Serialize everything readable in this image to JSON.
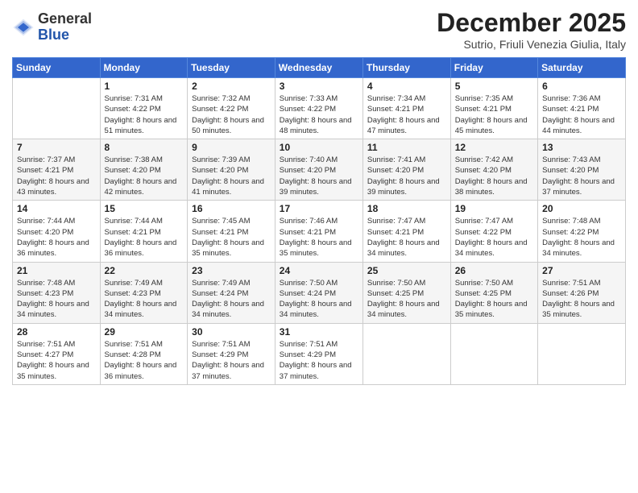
{
  "header": {
    "logo_general": "General",
    "logo_blue": "Blue",
    "month_title": "December 2025",
    "subtitle": "Sutrio, Friuli Venezia Giulia, Italy"
  },
  "weekdays": [
    "Sunday",
    "Monday",
    "Tuesday",
    "Wednesday",
    "Thursday",
    "Friday",
    "Saturday"
  ],
  "weeks": [
    [
      {
        "day": "",
        "sunrise": "",
        "sunset": "",
        "daylight": ""
      },
      {
        "day": "1",
        "sunrise": "Sunrise: 7:31 AM",
        "sunset": "Sunset: 4:22 PM",
        "daylight": "Daylight: 8 hours and 51 minutes."
      },
      {
        "day": "2",
        "sunrise": "Sunrise: 7:32 AM",
        "sunset": "Sunset: 4:22 PM",
        "daylight": "Daylight: 8 hours and 50 minutes."
      },
      {
        "day": "3",
        "sunrise": "Sunrise: 7:33 AM",
        "sunset": "Sunset: 4:22 PM",
        "daylight": "Daylight: 8 hours and 48 minutes."
      },
      {
        "day": "4",
        "sunrise": "Sunrise: 7:34 AM",
        "sunset": "Sunset: 4:21 PM",
        "daylight": "Daylight: 8 hours and 47 minutes."
      },
      {
        "day": "5",
        "sunrise": "Sunrise: 7:35 AM",
        "sunset": "Sunset: 4:21 PM",
        "daylight": "Daylight: 8 hours and 45 minutes."
      },
      {
        "day": "6",
        "sunrise": "Sunrise: 7:36 AM",
        "sunset": "Sunset: 4:21 PM",
        "daylight": "Daylight: 8 hours and 44 minutes."
      }
    ],
    [
      {
        "day": "7",
        "sunrise": "Sunrise: 7:37 AM",
        "sunset": "Sunset: 4:21 PM",
        "daylight": "Daylight: 8 hours and 43 minutes."
      },
      {
        "day": "8",
        "sunrise": "Sunrise: 7:38 AM",
        "sunset": "Sunset: 4:20 PM",
        "daylight": "Daylight: 8 hours and 42 minutes."
      },
      {
        "day": "9",
        "sunrise": "Sunrise: 7:39 AM",
        "sunset": "Sunset: 4:20 PM",
        "daylight": "Daylight: 8 hours and 41 minutes."
      },
      {
        "day": "10",
        "sunrise": "Sunrise: 7:40 AM",
        "sunset": "Sunset: 4:20 PM",
        "daylight": "Daylight: 8 hours and 39 minutes."
      },
      {
        "day": "11",
        "sunrise": "Sunrise: 7:41 AM",
        "sunset": "Sunset: 4:20 PM",
        "daylight": "Daylight: 8 hours and 39 minutes."
      },
      {
        "day": "12",
        "sunrise": "Sunrise: 7:42 AM",
        "sunset": "Sunset: 4:20 PM",
        "daylight": "Daylight: 8 hours and 38 minutes."
      },
      {
        "day": "13",
        "sunrise": "Sunrise: 7:43 AM",
        "sunset": "Sunset: 4:20 PM",
        "daylight": "Daylight: 8 hours and 37 minutes."
      }
    ],
    [
      {
        "day": "14",
        "sunrise": "Sunrise: 7:44 AM",
        "sunset": "Sunset: 4:20 PM",
        "daylight": "Daylight: 8 hours and 36 minutes."
      },
      {
        "day": "15",
        "sunrise": "Sunrise: 7:44 AM",
        "sunset": "Sunset: 4:21 PM",
        "daylight": "Daylight: 8 hours and 36 minutes."
      },
      {
        "day": "16",
        "sunrise": "Sunrise: 7:45 AM",
        "sunset": "Sunset: 4:21 PM",
        "daylight": "Daylight: 8 hours and 35 minutes."
      },
      {
        "day": "17",
        "sunrise": "Sunrise: 7:46 AM",
        "sunset": "Sunset: 4:21 PM",
        "daylight": "Daylight: 8 hours and 35 minutes."
      },
      {
        "day": "18",
        "sunrise": "Sunrise: 7:47 AM",
        "sunset": "Sunset: 4:21 PM",
        "daylight": "Daylight: 8 hours and 34 minutes."
      },
      {
        "day": "19",
        "sunrise": "Sunrise: 7:47 AM",
        "sunset": "Sunset: 4:22 PM",
        "daylight": "Daylight: 8 hours and 34 minutes."
      },
      {
        "day": "20",
        "sunrise": "Sunrise: 7:48 AM",
        "sunset": "Sunset: 4:22 PM",
        "daylight": "Daylight: 8 hours and 34 minutes."
      }
    ],
    [
      {
        "day": "21",
        "sunrise": "Sunrise: 7:48 AM",
        "sunset": "Sunset: 4:23 PM",
        "daylight": "Daylight: 8 hours and 34 minutes."
      },
      {
        "day": "22",
        "sunrise": "Sunrise: 7:49 AM",
        "sunset": "Sunset: 4:23 PM",
        "daylight": "Daylight: 8 hours and 34 minutes."
      },
      {
        "day": "23",
        "sunrise": "Sunrise: 7:49 AM",
        "sunset": "Sunset: 4:24 PM",
        "daylight": "Daylight: 8 hours and 34 minutes."
      },
      {
        "day": "24",
        "sunrise": "Sunrise: 7:50 AM",
        "sunset": "Sunset: 4:24 PM",
        "daylight": "Daylight: 8 hours and 34 minutes."
      },
      {
        "day": "25",
        "sunrise": "Sunrise: 7:50 AM",
        "sunset": "Sunset: 4:25 PM",
        "daylight": "Daylight: 8 hours and 34 minutes."
      },
      {
        "day": "26",
        "sunrise": "Sunrise: 7:50 AM",
        "sunset": "Sunset: 4:25 PM",
        "daylight": "Daylight: 8 hours and 35 minutes."
      },
      {
        "day": "27",
        "sunrise": "Sunrise: 7:51 AM",
        "sunset": "Sunset: 4:26 PM",
        "daylight": "Daylight: 8 hours and 35 minutes."
      }
    ],
    [
      {
        "day": "28",
        "sunrise": "Sunrise: 7:51 AM",
        "sunset": "Sunset: 4:27 PM",
        "daylight": "Daylight: 8 hours and 35 minutes."
      },
      {
        "day": "29",
        "sunrise": "Sunrise: 7:51 AM",
        "sunset": "Sunset: 4:28 PM",
        "daylight": "Daylight: 8 hours and 36 minutes."
      },
      {
        "day": "30",
        "sunrise": "Sunrise: 7:51 AM",
        "sunset": "Sunset: 4:29 PM",
        "daylight": "Daylight: 8 hours and 37 minutes."
      },
      {
        "day": "31",
        "sunrise": "Sunrise: 7:51 AM",
        "sunset": "Sunset: 4:29 PM",
        "daylight": "Daylight: 8 hours and 37 minutes."
      },
      {
        "day": "",
        "sunrise": "",
        "sunset": "",
        "daylight": ""
      },
      {
        "day": "",
        "sunrise": "",
        "sunset": "",
        "daylight": ""
      },
      {
        "day": "",
        "sunrise": "",
        "sunset": "",
        "daylight": ""
      }
    ]
  ]
}
